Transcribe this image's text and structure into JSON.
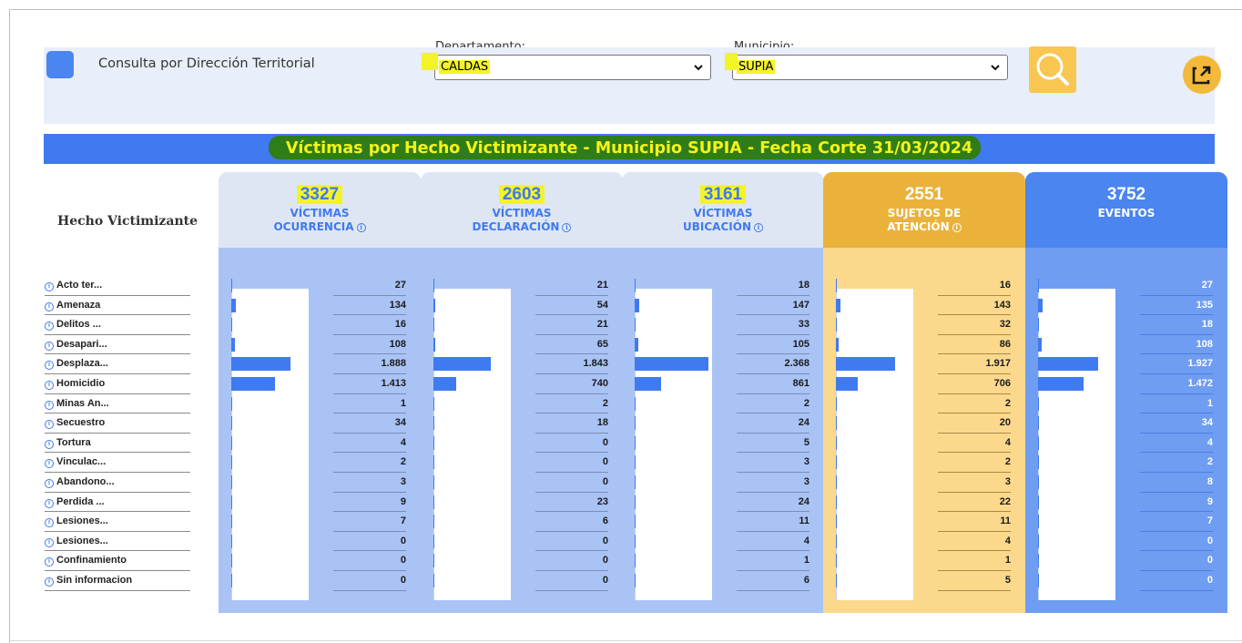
{
  "filters": {
    "consulta_label": "Consulta por Dirección Territorial",
    "departamento_label": "Departamento:",
    "departamento_value": "CALDAS",
    "municipio_label": "Municipio:",
    "municipio_value": "SUPIA"
  },
  "icons": {
    "search": "search-icon",
    "external": "external-link-icon",
    "chevron": "chevron-down-icon",
    "info": "info-icon"
  },
  "colors": {
    "primary_blue": "#3f7af0",
    "light_blue": "#a8c3f5",
    "orange": "#f2b93b",
    "highlight_yellow": "#f3f32c",
    "highlight_green": "#2e7d18"
  },
  "title": "Víctimas por Hecho Victimizante - Municipio SUPIA - Fecha Corte 31/03/2024",
  "row_header": "Hecho Victimizante",
  "rows": [
    "Acto ter...",
    "Amenaza",
    "Delitos ...",
    "Desapari...",
    "Desplaza...",
    "Homicidio",
    "Minas An...",
    "Secuestro",
    "Tortura",
    "Vinculac...",
    "Abandono...",
    "Perdida ...",
    "Lesiones...",
    "Lesiones...",
    "Confinamiento",
    "Sin informacion"
  ],
  "columns": [
    {
      "total": "3327",
      "line1": "VÍCTIMAS",
      "line2": "OCURRENCIA",
      "values": [
        "27",
        "134",
        "16",
        "108",
        "1.888",
        "1.413",
        "1",
        "34",
        "4",
        "2",
        "3",
        "9",
        "7",
        "0",
        "0",
        "0"
      ],
      "amounts": [
        27,
        134,
        16,
        108,
        1888,
        1413,
        1,
        34,
        4,
        2,
        3,
        9,
        7,
        0,
        0,
        0
      ]
    },
    {
      "total": "2603",
      "line1": "VÍCTIMAS",
      "line2": "DECLARACIÓN",
      "values": [
        "21",
        "54",
        "21",
        "65",
        "1.843",
        "740",
        "2",
        "18",
        "0",
        "0",
        "0",
        "23",
        "6",
        "0",
        "0",
        "0"
      ],
      "amounts": [
        21,
        54,
        21,
        65,
        1843,
        740,
        2,
        18,
        0,
        0,
        0,
        23,
        6,
        0,
        0,
        0
      ]
    },
    {
      "total": "3161",
      "line1": "VÍCTIMAS",
      "line2": "UBICACIÓN",
      "values": [
        "18",
        "147",
        "33",
        "105",
        "2.368",
        "861",
        "2",
        "24",
        "5",
        "3",
        "3",
        "24",
        "11",
        "4",
        "1",
        "6"
      ],
      "amounts": [
        18,
        147,
        33,
        105,
        2368,
        861,
        2,
        24,
        5,
        3,
        3,
        24,
        11,
        4,
        1,
        6
      ]
    },
    {
      "total": "2551",
      "line1": "SUJETOS DE",
      "line2": "ATENCIÓN",
      "values": [
        "16",
        "143",
        "32",
        "86",
        "1.917",
        "706",
        "2",
        "20",
        "4",
        "2",
        "3",
        "22",
        "11",
        "4",
        "1",
        "5"
      ],
      "amounts": [
        16,
        143,
        32,
        86,
        1917,
        706,
        2,
        20,
        4,
        2,
        3,
        22,
        11,
        4,
        1,
        5
      ]
    },
    {
      "total": "3752",
      "line1": "EVENTOS",
      "line2": "",
      "values": [
        "27",
        "135",
        "18",
        "108",
        "1.927",
        "1.472",
        "1",
        "34",
        "4",
        "2",
        "8",
        "9",
        "7",
        "0",
        "0",
        "0"
      ],
      "amounts": [
        27,
        135,
        18,
        108,
        1927,
        1472,
        1,
        34,
        4,
        2,
        8,
        9,
        7,
        0,
        0,
        0
      ]
    }
  ]
}
